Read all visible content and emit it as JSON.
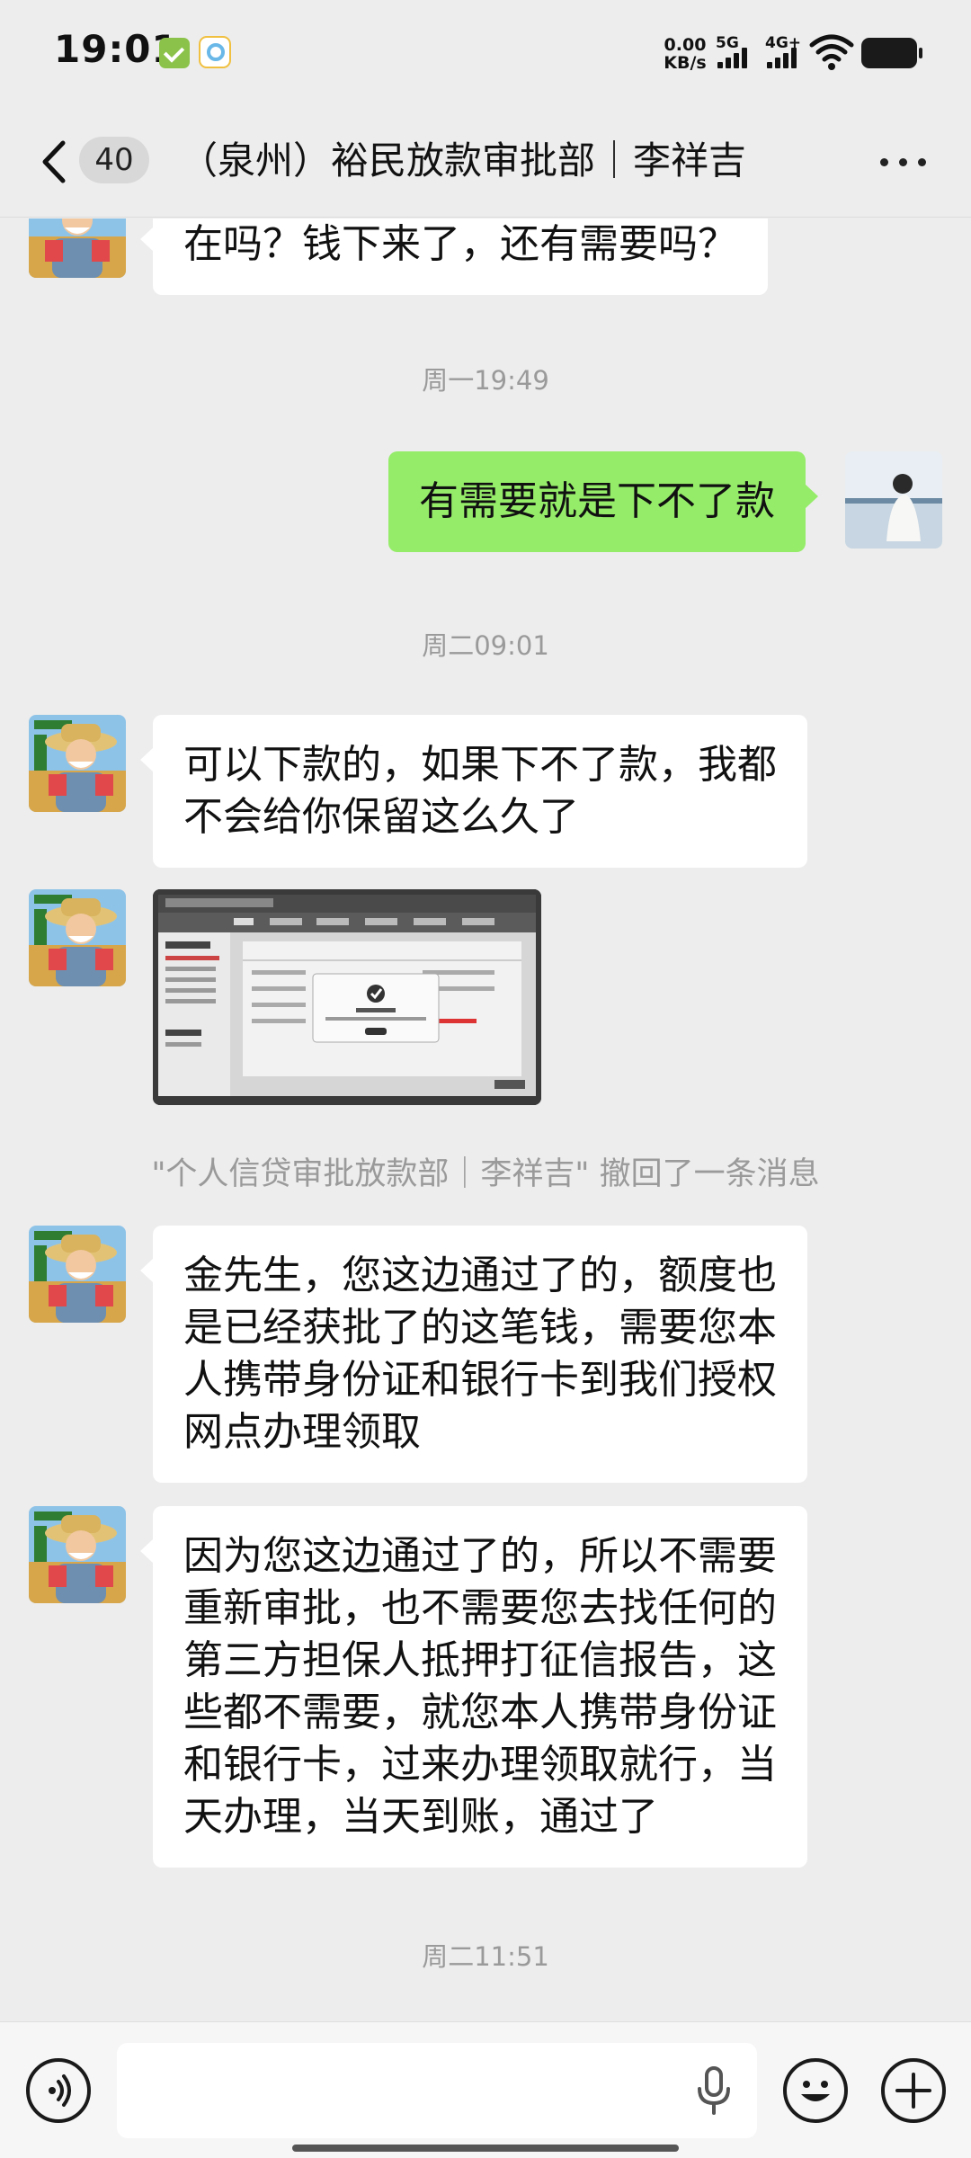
{
  "status_bar": {
    "time": "19:01",
    "net_speed_value": "0.00",
    "net_speed_unit": "KB/s",
    "sim1": "5G",
    "sim2": "4G+"
  },
  "nav": {
    "back_icon": "chevron-left-icon",
    "unread_count": "40",
    "title": "（泉州）裕民放款审批部｜李祥吉",
    "more_icon": "more-dots-icon"
  },
  "messages": {
    "m0": {
      "text": "在吗？钱下来了，还有需要吗？"
    },
    "ts1": "周一19:49",
    "m1": {
      "text": "有需要就是下不了款"
    },
    "ts2": "周二09:01",
    "m2": {
      "lines": [
        "可以下款的，如果下不了款，我都",
        "不会给你保留这么久了"
      ]
    },
    "m3": {
      "image_icon": "approval-screenshot-image"
    },
    "recall_notice": "\"个人信贷审批放款部｜李祥吉\" 撤回了一条消息",
    "m4": {
      "lines": [
        "金先生，您这边通过了的，额度也",
        "是已经获批了的这笔钱，需要您本",
        "人携带身份证和银行卡到我们授权",
        "网点办理领取"
      ]
    },
    "m5": {
      "lines": [
        "因为您这边通过了的，所以不需要",
        "重新审批，也不需要您去找任何的",
        "第三方担保人抵押打征信报告，这",
        "些都不需要，就您本人携带身份证",
        "和银行卡，过来办理领取就行，当",
        "天办理，当天到账，通过了"
      ]
    },
    "ts3": "周二11:51"
  },
  "input_bar": {
    "voice_icon": "voice-mode-icon",
    "mic_icon": "microphone-icon",
    "emoji_icon": "emoji-icon",
    "plus_icon": "plus-icon",
    "text_value": ""
  },
  "colors": {
    "background": "#EDEDED",
    "bubble_sent": "#95EC69",
    "bubble_received": "#FFFFFF",
    "timestamp": "#9A9A9A"
  }
}
